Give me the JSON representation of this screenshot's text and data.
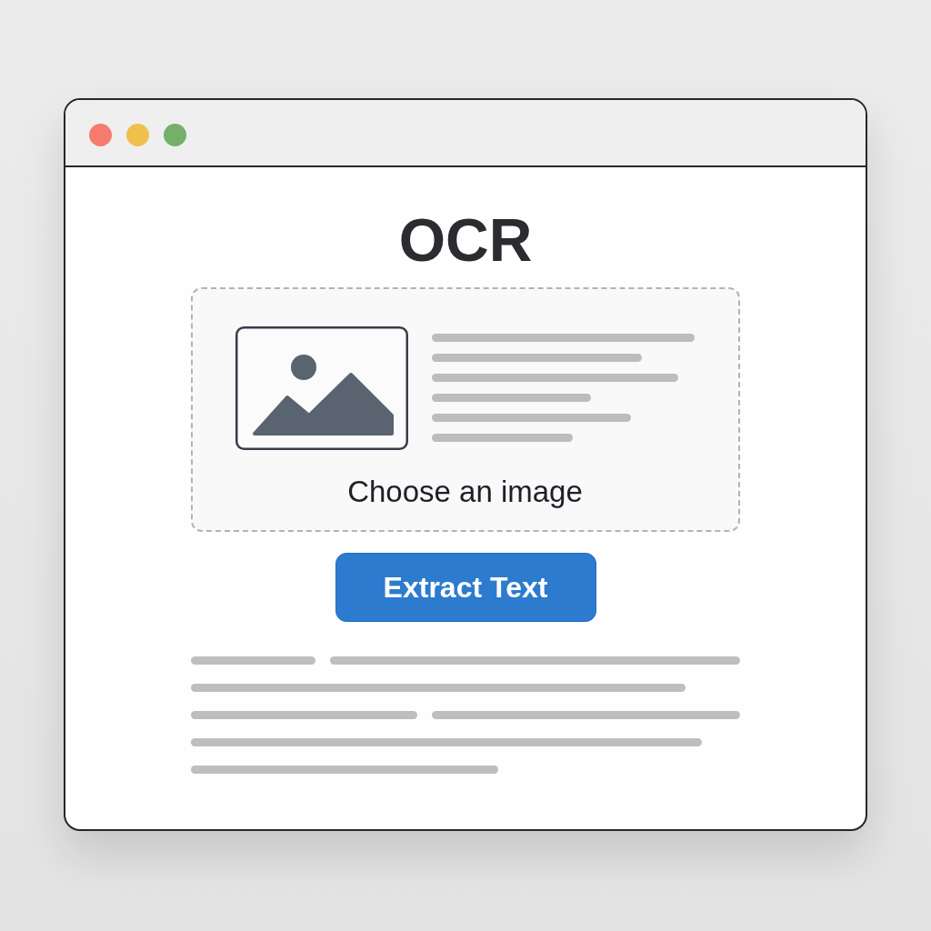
{
  "window": {
    "controls": [
      {
        "color": "#f77b6e"
      },
      {
        "color": "#efc04b"
      },
      {
        "color": "#74b06a"
      }
    ]
  },
  "title": "OCR",
  "dropzone": {
    "label": "Choose an image"
  },
  "button": {
    "label": "Extract Text"
  }
}
